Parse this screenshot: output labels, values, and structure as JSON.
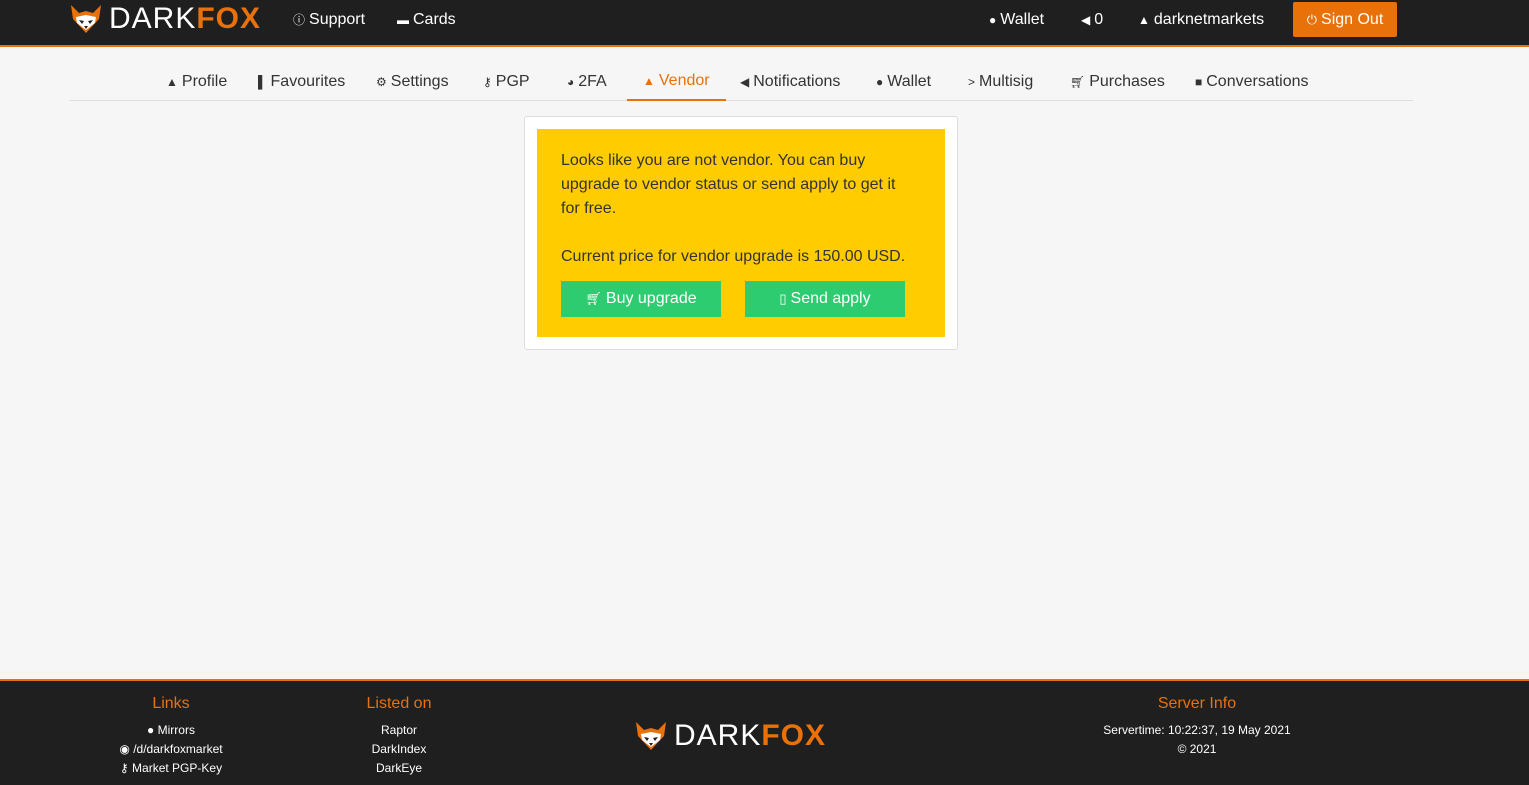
{
  "brand": {
    "dark": "DARK",
    "fox": "FOX",
    "accent": "#e8710a",
    "icon": "fox-logo-icon"
  },
  "topnav": {
    "support": {
      "icon": "info-circle-icon",
      "label": "Support"
    },
    "cards": {
      "icon": "credit-card-icon",
      "label": "Cards"
    },
    "wallet": {
      "icon": "bitcoin-icon",
      "label": "Wallet"
    },
    "notifications": {
      "icon": "bullhorn-icon",
      "label": "0"
    },
    "user": {
      "icon": "user-icon",
      "label": "darknetmarkets"
    },
    "signout": {
      "icon": "power-icon",
      "label": "Sign Out"
    }
  },
  "tabs": [
    {
      "icon": "user-icon",
      "label": "Profile"
    },
    {
      "icon": "bookmark-icon",
      "label": "Favourites"
    },
    {
      "icon": "gear-icon",
      "label": "Settings"
    },
    {
      "icon": "key-icon",
      "label": "PGP"
    },
    {
      "icon": "shield-icon",
      "label": "2FA"
    },
    {
      "icon": "vendor-icon",
      "label": "Vendor",
      "active": true
    },
    {
      "icon": "bullhorn-icon",
      "label": "Notifications"
    },
    {
      "icon": "bitcoin-icon",
      "label": "Wallet"
    },
    {
      "icon": "chevron-right-icon",
      "label": "Multisig"
    },
    {
      "icon": "cart-icon",
      "label": "Purchases"
    },
    {
      "icon": "comments-icon",
      "label": "Conversations"
    }
  ],
  "vendor_panel": {
    "message": "Looks like you are not vendor. You can buy upgrade to vendor status or send apply to get it for free.",
    "price_text": "Current price for vendor upgrade is 150.00 USD.",
    "buy_button": {
      "icon": "cart-icon",
      "label": "Buy upgrade"
    },
    "apply_button": {
      "icon": "file-icon",
      "label": "Send apply"
    },
    "alert_color": "#ffcc00",
    "button_color": "#2ecc71"
  },
  "footer": {
    "links": {
      "heading": "Links",
      "items": [
        {
          "icon": "globe-icon",
          "label": "Mirrors"
        },
        {
          "icon": "reddit-icon",
          "label": "/d/darkfoxmarket"
        },
        {
          "icon": "key-icon",
          "label": "Market PGP-Key"
        }
      ]
    },
    "listed_on": {
      "heading": "Listed on",
      "items": [
        "Raptor",
        "DarkIndex",
        "DarkEye"
      ]
    },
    "server_info": {
      "heading": "Server Info",
      "servertime": "Servertime: 10:22:37, 19 May 2021",
      "copyright": "© 2021"
    }
  }
}
